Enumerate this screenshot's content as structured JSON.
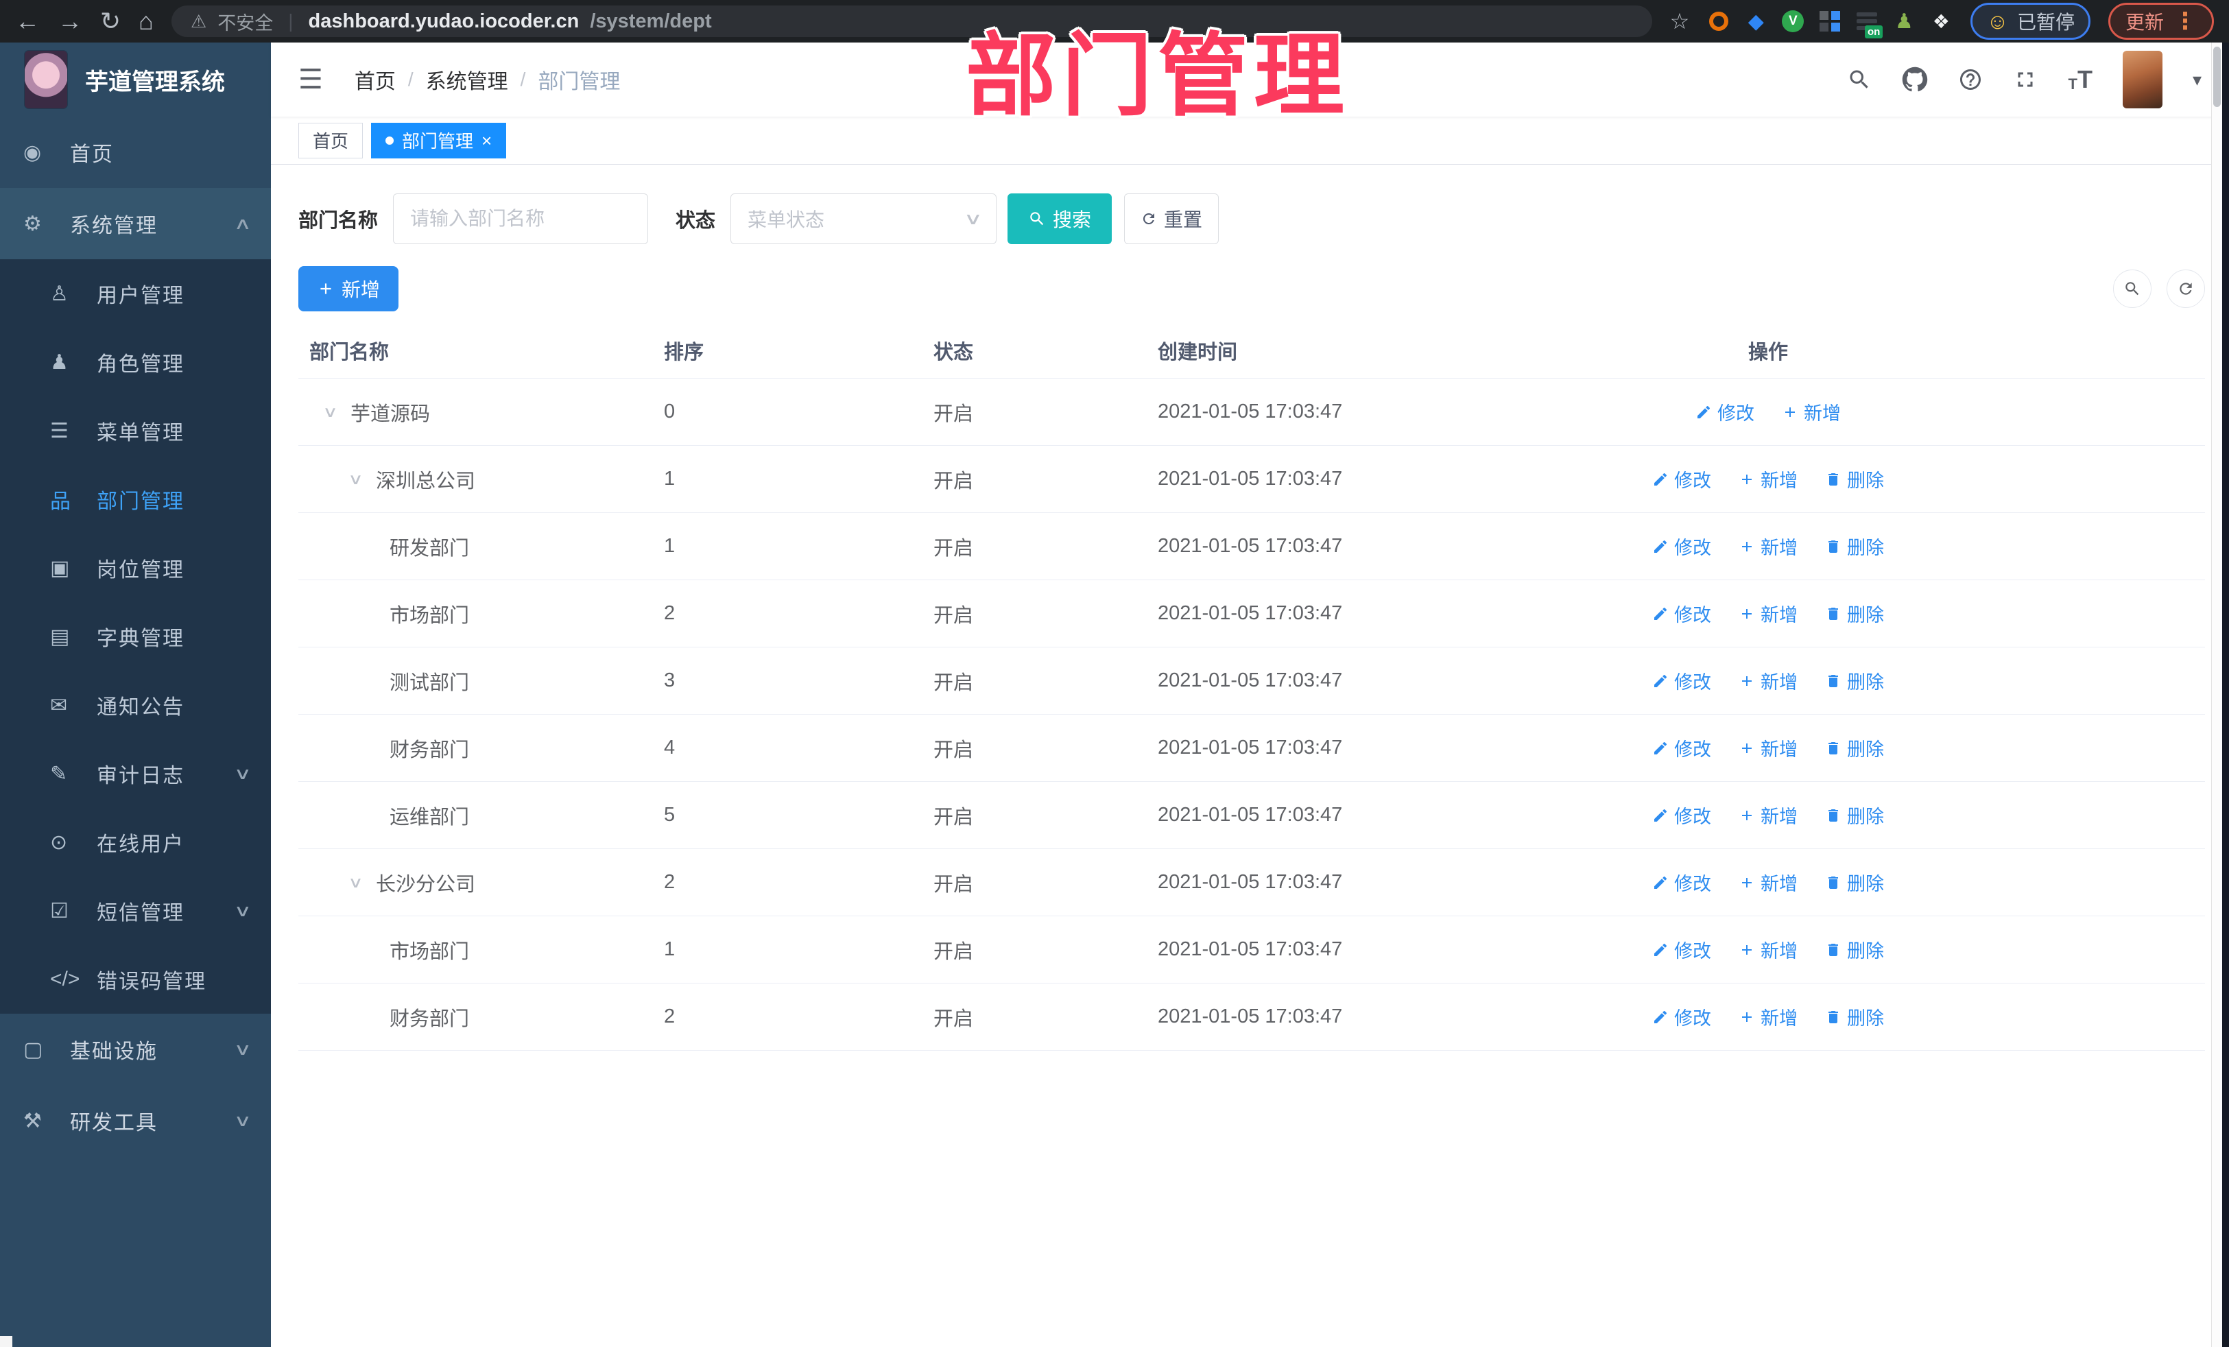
{
  "browser": {
    "security_label": "不安全",
    "url_host": "dashboard.yudao.iocoder.cn",
    "url_path": "/system/dept",
    "paused_label": "已暂停",
    "update_label": "更新"
  },
  "annotation": {
    "text": "部门管理"
  },
  "header": {
    "logo_title": "芋道管理系统",
    "breadcrumb": [
      "首页",
      "系统管理",
      "部门管理"
    ]
  },
  "tabs": [
    {
      "label": "首页",
      "active": false
    },
    {
      "label": "部门管理",
      "active": true
    }
  ],
  "sidebar": {
    "items": [
      {
        "key": "home",
        "label": "首页",
        "icon": "home",
        "level": 0
      },
      {
        "key": "system",
        "label": "系统管理",
        "icon": "system",
        "level": 0,
        "arrow": "up",
        "highlight": true
      },
      {
        "key": "user",
        "label": "用户管理",
        "icon": "user",
        "level": 1
      },
      {
        "key": "role",
        "label": "角色管理",
        "icon": "role",
        "level": 1
      },
      {
        "key": "menu",
        "label": "菜单管理",
        "icon": "menu",
        "level": 1
      },
      {
        "key": "dept",
        "label": "部门管理",
        "icon": "dept",
        "level": 1,
        "active": true
      },
      {
        "key": "post",
        "label": "岗位管理",
        "icon": "post",
        "level": 1
      },
      {
        "key": "dict",
        "label": "字典管理",
        "icon": "dict",
        "level": 1
      },
      {
        "key": "notice",
        "label": "通知公告",
        "icon": "notice",
        "level": 1
      },
      {
        "key": "audit",
        "label": "审计日志",
        "icon": "audit",
        "level": 1,
        "arrow": "down"
      },
      {
        "key": "online",
        "label": "在线用户",
        "icon": "online",
        "level": 1
      },
      {
        "key": "sms",
        "label": "短信管理",
        "icon": "sms",
        "level": 1,
        "arrow": "down"
      },
      {
        "key": "errcode",
        "label": "错误码管理",
        "icon": "errcode",
        "level": 1
      },
      {
        "key": "infra",
        "label": "基础设施",
        "icon": "infra",
        "level": 0,
        "arrow": "down"
      },
      {
        "key": "tools",
        "label": "研发工具",
        "icon": "tools",
        "level": 0,
        "arrow": "down"
      }
    ]
  },
  "filters": {
    "dept_label": "部门名称",
    "dept_placeholder": "请输入部门名称",
    "status_label": "状态",
    "status_placeholder": "菜单状态",
    "search_label": "搜索",
    "reset_label": "重置"
  },
  "toolbar": {
    "add_label": "新增"
  },
  "table": {
    "columns": [
      "部门名称",
      "排序",
      "状态",
      "创建时间",
      "操作"
    ],
    "action_labels": {
      "edit": "修改",
      "add": "新增",
      "delete": "删除"
    },
    "rows": [
      {
        "name": "芋道源码",
        "level": 0,
        "expandable": true,
        "sort": "0",
        "status": "开启",
        "created": "2021-01-05 17:03:47",
        "actions": [
          "edit",
          "add"
        ]
      },
      {
        "name": "深圳总公司",
        "level": 1,
        "expandable": true,
        "sort": "1",
        "status": "开启",
        "created": "2021-01-05 17:03:47",
        "actions": [
          "edit",
          "add",
          "delete"
        ]
      },
      {
        "name": "研发部门",
        "level": 2,
        "expandable": false,
        "sort": "1",
        "status": "开启",
        "created": "2021-01-05 17:03:47",
        "actions": [
          "edit",
          "add",
          "delete"
        ]
      },
      {
        "name": "市场部门",
        "level": 2,
        "expandable": false,
        "sort": "2",
        "status": "开启",
        "created": "2021-01-05 17:03:47",
        "actions": [
          "edit",
          "add",
          "delete"
        ]
      },
      {
        "name": "测试部门",
        "level": 2,
        "expandable": false,
        "sort": "3",
        "status": "开启",
        "created": "2021-01-05 17:03:47",
        "actions": [
          "edit",
          "add",
          "delete"
        ]
      },
      {
        "name": "财务部门",
        "level": 2,
        "expandable": false,
        "sort": "4",
        "status": "开启",
        "created": "2021-01-05 17:03:47",
        "actions": [
          "edit",
          "add",
          "delete"
        ]
      },
      {
        "name": "运维部门",
        "level": 2,
        "expandable": false,
        "sort": "5",
        "status": "开启",
        "created": "2021-01-05 17:03:47",
        "actions": [
          "edit",
          "add",
          "delete"
        ]
      },
      {
        "name": "长沙分公司",
        "level": 1,
        "expandable": true,
        "sort": "2",
        "status": "开启",
        "created": "2021-01-05 17:03:47",
        "actions": [
          "edit",
          "add",
          "delete"
        ]
      },
      {
        "name": "市场部门",
        "level": 2,
        "expandable": false,
        "sort": "1",
        "status": "开启",
        "created": "2021-01-05 17:03:47",
        "actions": [
          "edit",
          "add",
          "delete"
        ]
      },
      {
        "name": "财务部门",
        "level": 2,
        "expandable": false,
        "sort": "2",
        "status": "开启",
        "created": "2021-01-05 17:03:47",
        "actions": [
          "edit",
          "add",
          "delete"
        ]
      }
    ]
  },
  "colors": {
    "accent_blue": "#2d8cf0",
    "active_tab_blue": "#1890ff",
    "search_teal": "#1abcbb",
    "sidebar_bg": "#2d4a63",
    "submenu_bg": "#203449",
    "annotation_pink": "#fb3a5d"
  }
}
